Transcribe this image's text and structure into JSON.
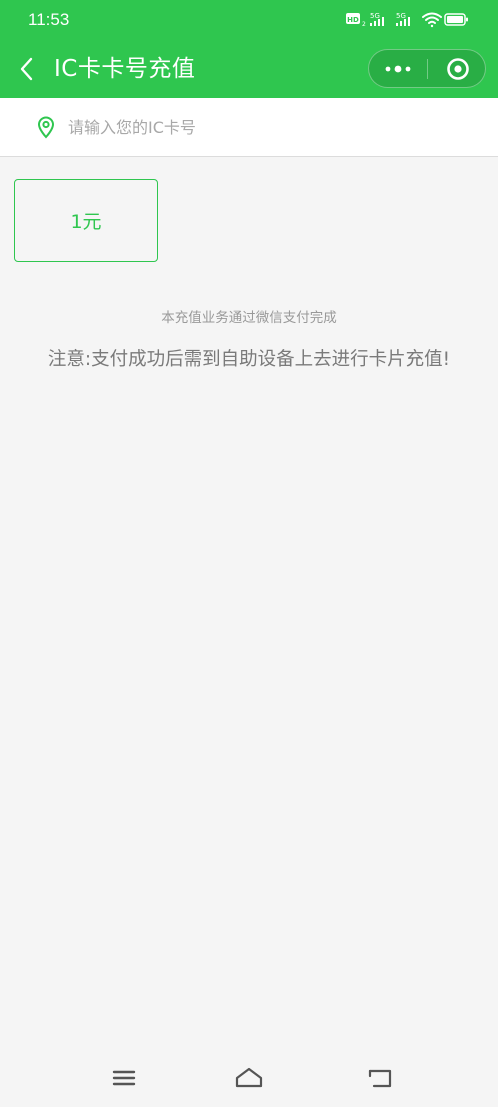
{
  "status_bar": {
    "time": "11:53",
    "icons": [
      "hd-icon",
      "5g-signal-icon",
      "5g-signal-icon",
      "wifi-icon",
      "battery-icon"
    ]
  },
  "nav_bar": {
    "title": "IC卡卡号充值",
    "back_icon": "chevron-left-icon",
    "more_icon": "more-dots-icon",
    "close_icon": "target-circle-icon"
  },
  "search": {
    "icon": "location-pin-icon",
    "placeholder": "请输入您的IC卡号",
    "value": ""
  },
  "amounts": [
    {
      "label": "1元"
    }
  ],
  "notes": {
    "service": "本充值业务通过微信支付完成",
    "warning": "注意:支付成功后需到自助设备上去进行卡片充值!"
  },
  "colors": {
    "accent": "#2fc64f",
    "background": "#f5f5f5",
    "muted_text": "#999999",
    "warning_text": "#7a7a7a"
  },
  "system_nav": {
    "icons": [
      "menu-icon",
      "home-icon",
      "back-icon"
    ]
  }
}
